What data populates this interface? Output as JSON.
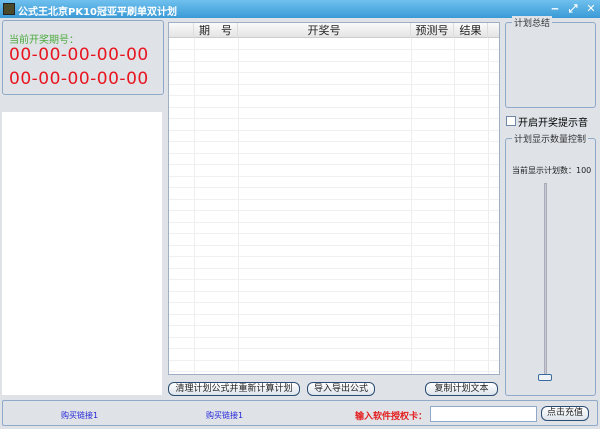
{
  "window": {
    "title": "公式王北京PK10冠亚平刷单双计划",
    "minimize": "‒",
    "maximize": "⤢",
    "close": "✕"
  },
  "current": {
    "label": "当前开奖期号：",
    "line1": "00-00-00-00-00",
    "line2": "00-00-00-00-00"
  },
  "table": {
    "columns": [
      "",
      "期　号",
      "开奖号",
      "预测号",
      "结果"
    ],
    "rows": []
  },
  "buttons": {
    "clear": "清理计划公式并重新计算计划",
    "import": "导入导出公式",
    "copy": "复制计划文本"
  },
  "summary": {
    "title": "计划总结"
  },
  "sound": {
    "label": "开启开奖提示音",
    "checked": false
  },
  "control": {
    "title": "计划显示数量控制",
    "count_label": "当前显示计划数：",
    "count": "100",
    "slider_value": 100
  },
  "bottom": {
    "link1": "购买链接1",
    "link2": "购买链接1",
    "card_label": "输入软件授权卡：",
    "card_value": "",
    "recharge": "点击充值"
  }
}
